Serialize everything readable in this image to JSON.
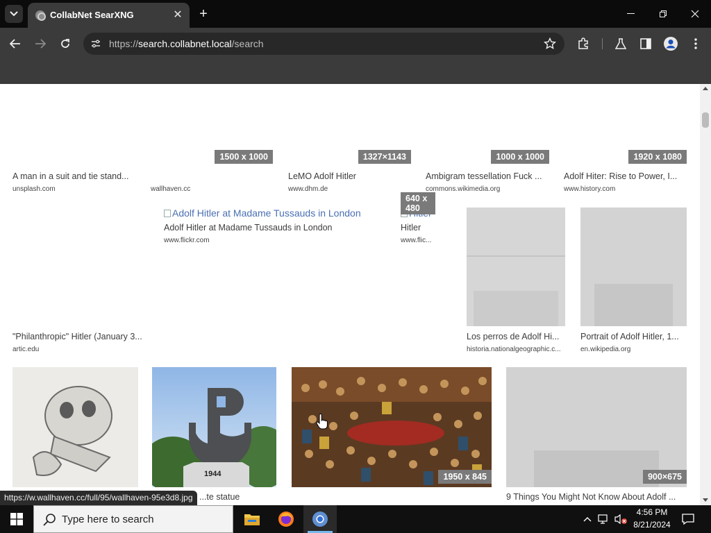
{
  "tab": {
    "title": "CollabNet SearXNG"
  },
  "address_bar": {
    "scheme": "https://",
    "host": "search.collabnet.local",
    "path": "/search"
  },
  "results": [
    {
      "title": "A man in a suit and tie stand...",
      "url": "unsplash.com"
    },
    {
      "title": "",
      "url": "wallhaven.cc",
      "resolution": "1500 x 1000"
    },
    {
      "title": "LeMO Adolf Hitler",
      "url": "www.dhm.de",
      "resolution": "1327×1143"
    },
    {
      "title": "Ambigram tessellation Fuck ...",
      "url": "commons.wikimedia.org",
      "resolution": "1000 x 1000"
    },
    {
      "title": "Adolf Hiter: Rise to Power, I...",
      "url": "www.history.com",
      "resolution": "1920 x 1080"
    },
    {
      "title": "Adolf Hitler at Madame Tussauds in London",
      "url": "www.flickr.com",
      "alt": "Adolf Hitler at Madame Tussauds in London"
    },
    {
      "title": "Hitler",
      "url": "www.flic...",
      "alt": "Hitler",
      "resolution": "640 x 480"
    },
    {
      "title": "\"Philanthropic\" Hitler (January 3...",
      "url": "artic.edu"
    },
    {
      "title": "Los perros de Adolf Hi...",
      "url": "historia.nationalgeographic.c..."
    },
    {
      "title": "Portrait of Adolf Hitler, 1...",
      "url": "en.wikipedia.org"
    },
    {
      "title": "",
      "url": ""
    },
    {
      "title": "...te statue",
      "url": ""
    },
    {
      "title": "",
      "url": "",
      "resolution": "1950 x 845"
    },
    {
      "title": "9 Things You Might Not Know About Adolf ...",
      "url": "",
      "resolution": "900×675"
    }
  ],
  "status_url": "https://w.wallhaven.cc/full/95/wallhaven-95e3d8.jpg",
  "taskbar": {
    "search_placeholder": "Type here to search",
    "time": "4:56 PM",
    "date": "8/21/2024"
  },
  "colors": {
    "tab_strip": "#0b0b0b",
    "toolbar": "#3b3b3b",
    "omnibox": "#282828",
    "taskbar": "#101010",
    "badge": "#7a7a7a"
  },
  "icons": [
    "tab-search-icon",
    "close-icon",
    "plus-icon",
    "minimize-icon",
    "restore-icon",
    "back-icon",
    "forward-icon",
    "reload-icon",
    "site-info-icon",
    "star-icon",
    "extensions-icon",
    "labs-icon",
    "sidebar-icon",
    "profile-icon",
    "menu-icon",
    "windows-icon",
    "search-icon",
    "file-explorer-icon",
    "firefox-icon",
    "chrome-icon",
    "chevron-up-icon",
    "network-icon",
    "volume-muted-icon",
    "notification-icon",
    "hand-cursor-icon"
  ]
}
